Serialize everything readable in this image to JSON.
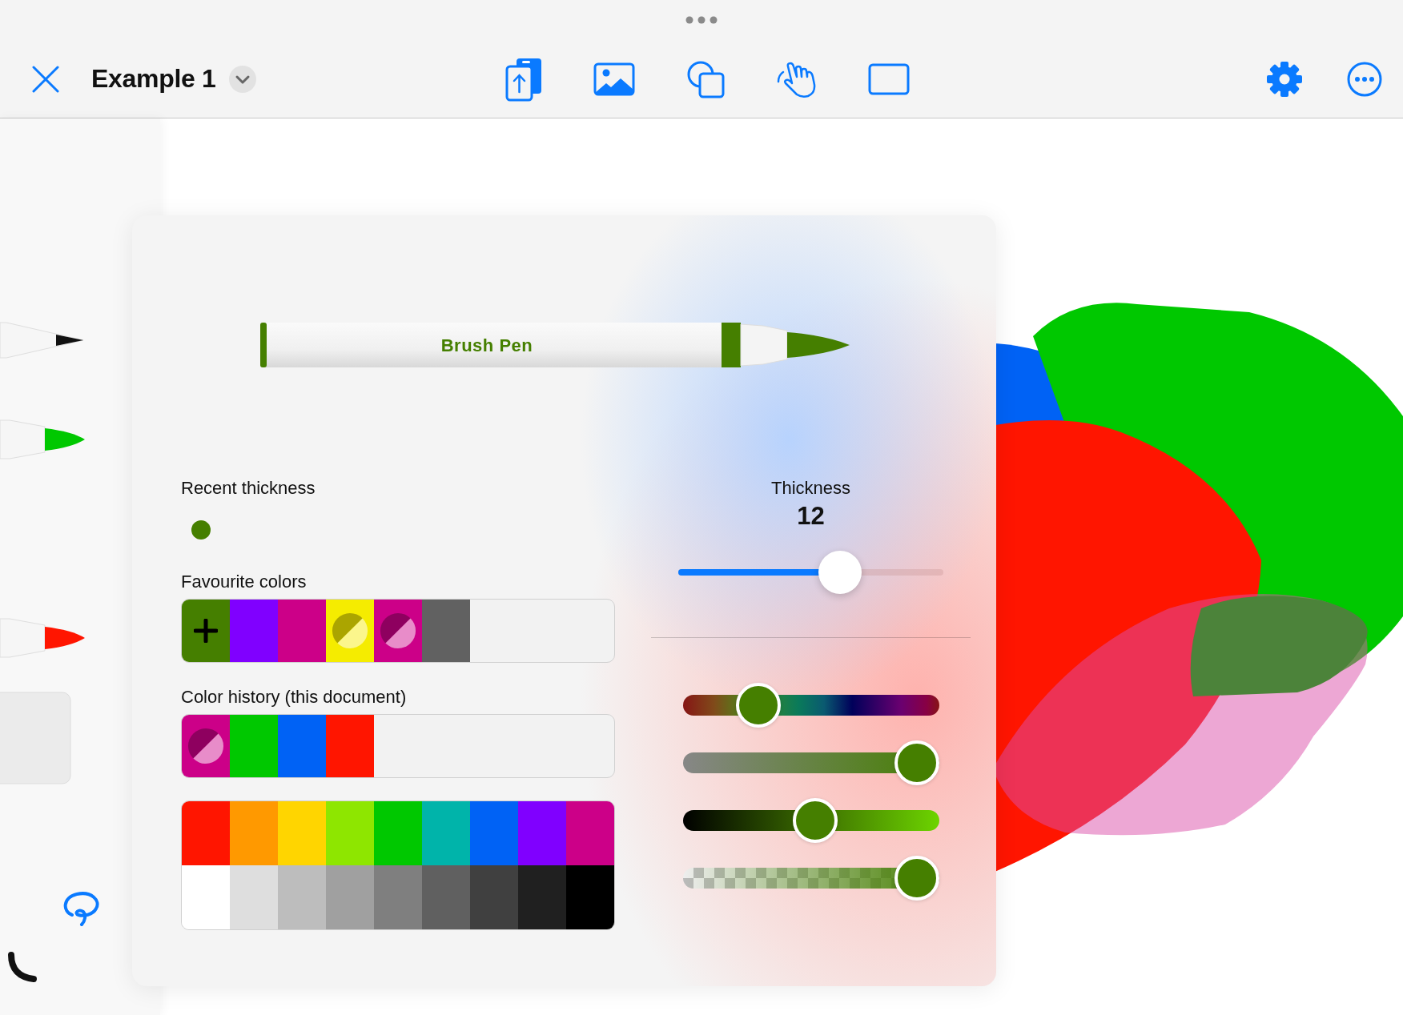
{
  "window": {
    "title": "Example 1"
  },
  "tool_rail": [
    {
      "kind": "fineliner",
      "color": "#111111"
    },
    {
      "kind": "brush",
      "color": "#00c800"
    },
    {
      "kind": "brush",
      "color": "#ff1500"
    },
    {
      "kind": "eraser"
    },
    {
      "kind": "lasso"
    },
    {
      "kind": "curve"
    }
  ],
  "panel": {
    "pen": {
      "label": "Brush Pen",
      "color": "#457f00"
    },
    "recent_thickness": {
      "label": "Recent thickness",
      "items": [
        {
          "color": "#457f00"
        }
      ]
    },
    "favourite_colors": {
      "label": "Favourite colors",
      "items": [
        {
          "kind": "add",
          "color": "#457f00"
        },
        {
          "kind": "solid",
          "color": "#8000ff"
        },
        {
          "kind": "solid",
          "color": "#cc0088"
        },
        {
          "kind": "translucent",
          "color": "#f5ec00"
        },
        {
          "kind": "translucent",
          "color": "#cc0088"
        },
        {
          "kind": "solid",
          "color": "#616161"
        }
      ]
    },
    "color_history": {
      "label": "Color history (this document)",
      "items": [
        {
          "kind": "translucent",
          "color": "#cc0088"
        },
        {
          "kind": "solid",
          "color": "#00c800"
        },
        {
          "kind": "solid",
          "color": "#0062f5"
        },
        {
          "kind": "solid",
          "color": "#ff1500"
        }
      ]
    },
    "palette": [
      {
        "color": "#ff1500"
      },
      {
        "color": "#ff9900"
      },
      {
        "color": "#ffd500"
      },
      {
        "color": "#8ee600"
      },
      {
        "color": "#00c800"
      },
      {
        "color": "#00b4aa"
      },
      {
        "color": "#0062f5"
      },
      {
        "color": "#8000ff"
      },
      {
        "color": "#cc0088"
      },
      {
        "color": "#ffffff"
      },
      {
        "color": "#dedede"
      },
      {
        "color": "#bdbdbd"
      },
      {
        "color": "#a0a0a0"
      },
      {
        "color": "#7f7f7f"
      },
      {
        "color": "#606060"
      },
      {
        "color": "#404040"
      },
      {
        "color": "#202020"
      },
      {
        "color": "#000000"
      }
    ],
    "thickness": {
      "label": "Thickness",
      "value": "12",
      "level": 0.63
    },
    "color_sliders": [
      {
        "kind": "hue",
        "level": 0.25
      },
      {
        "kind": "saturation",
        "level": 1
      },
      {
        "kind": "brightness",
        "level": 0.52
      },
      {
        "kind": "opacity",
        "level": 1
      }
    ]
  }
}
